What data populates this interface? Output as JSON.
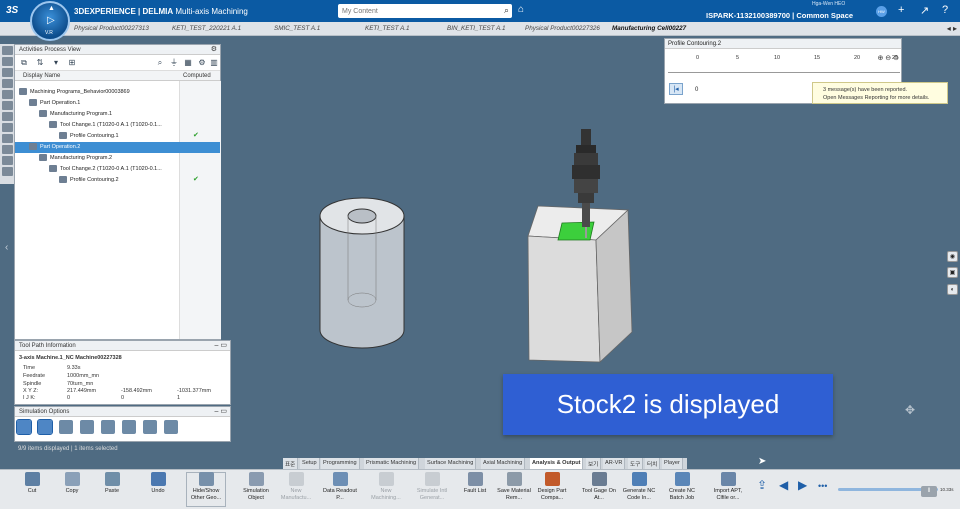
{
  "app": {
    "logo": "3S",
    "brand_bold": "3DEXPERIENCE | DELMIA",
    "brand_app": "Multi-axis Machining",
    "compass_version": "V.R",
    "search_placeholder": "My Content",
    "user_name": "Hga-Wen HEO",
    "space_label": "ISPARK-1132100389700 | Common Space",
    "avatar_initials": "HW"
  },
  "tabs": [
    {
      "label": "Physical Product00227313"
    },
    {
      "label": "KETI_TEST_220221 A.1"
    },
    {
      "label": "SMIC_TEST A.1"
    },
    {
      "label": "KETI_TEST A.1"
    },
    {
      "label": "BIN_KETI_TEST A.1"
    },
    {
      "label": "Physical Product00227326"
    },
    {
      "label": "Manufacturing Cell00227"
    }
  ],
  "tree_panel": {
    "title": "Activities Process View",
    "col_display": "Display Name",
    "col_computed": "Computed",
    "rows": [
      {
        "label": "Machining Programs_Behavior00003869"
      },
      {
        "label": "Part Operation.1"
      },
      {
        "label": "Manufacturing Program.1"
      },
      {
        "label": "Tool Change.1 (T1020-0 A.1 (T1020-0.1..."
      },
      {
        "label": "Profile Contouring.1"
      },
      {
        "label": "Part Operation.2"
      },
      {
        "label": "Manufacturing Program.2"
      },
      {
        "label": "Tool Change.2 (T1020-0 A.1 (T1020-0.1..."
      },
      {
        "label": "Profile Contouring.2"
      }
    ]
  },
  "toolpath_panel": {
    "title": "Tool Path Information",
    "machine": "3-axis Machine.1_NC Machine00227328",
    "time_label": "Time",
    "time_value": "9.33s",
    "feedrate_label": "Feedrate",
    "feedrate_value": "1000mm_mn",
    "spindle_label": "Spindle",
    "spindle_value": "70turn_mn",
    "xyz_label": "X Y Z:",
    "x_value": "217.449mm",
    "y_value": "-158.492mm",
    "z_value": "-1031.377mm",
    "ijk_label": "I J K:",
    "i_value": "0",
    "j_value": "0",
    "k_value": "1"
  },
  "sim_options": {
    "title": "Simulation Options"
  },
  "status_line": "9/9 items displayed | 1 items selected",
  "profile_panel": {
    "title": "Profile Contouring.2",
    "ticks": [
      "0",
      "5",
      "10",
      "15",
      "20",
      "25"
    ],
    "current_value": "0"
  },
  "tooltip": {
    "line1": "3 message(s) have been reported.",
    "line2": "Open Messages Reporting for more details."
  },
  "caption": "Stock2 is displayed",
  "app_tabs": [
    {
      "label": "표준"
    },
    {
      "label": "Setup"
    },
    {
      "label": "Programming"
    },
    {
      "label": "Prismatic Machining"
    },
    {
      "label": "Surface Machining"
    },
    {
      "label": "Axial Machining"
    },
    {
      "label": "Analysis & Output"
    },
    {
      "label": "보기"
    },
    {
      "label": "AR-VR"
    },
    {
      "label": "도구"
    },
    {
      "label": "터치"
    },
    {
      "label": "Player"
    }
  ],
  "bottom_tools": [
    {
      "label": "Cut",
      "color": "#5d7fa3"
    },
    {
      "label": "Copy",
      "color": "#8aa0b8"
    },
    {
      "label": "Paste",
      "color": "#6f8ea8"
    },
    {
      "label": "Undo",
      "color": "#4b78b0"
    },
    {
      "label": "Hide/Show Other Geo...",
      "color": "#7790aa"
    },
    {
      "label": "Simulation Object",
      "color": "#8a9bb0"
    },
    {
      "label": "New Manufactu...",
      "color": "#c8cdd2"
    },
    {
      "label": "Data Readout P...",
      "color": "#6d8fb5"
    },
    {
      "label": "New Machining...",
      "color": "#c8cdd2"
    },
    {
      "label": "Simulate Intl Generat...",
      "color": "#c8cdd2"
    },
    {
      "label": "Fault List",
      "color": "#7d8fa6"
    },
    {
      "label": "Save Material Rem...",
      "color": "#8c9aa8"
    },
    {
      "label": "Design Part Compa...",
      "color": "#c25a2a"
    },
    {
      "label": "Tool Gage On At...",
      "color": "#6a7c92"
    },
    {
      "label": "Generate NC Code In...",
      "color": "#4f7fb6"
    },
    {
      "label": "Create NC Batch Job",
      "color": "#5a86b8"
    },
    {
      "label": "Import APT, Clfile or...",
      "color": "#6a86a8"
    }
  ],
  "player": {
    "time": "10.33s"
  },
  "colors": {
    "topbar": "#0b5aa3",
    "viewport": "#4f6b82",
    "caption_bg": "#2f5fd3",
    "selection": "#3d8ed3",
    "stock_fill": "#d9d9d9",
    "green_highlight": "#3ccf3c"
  }
}
